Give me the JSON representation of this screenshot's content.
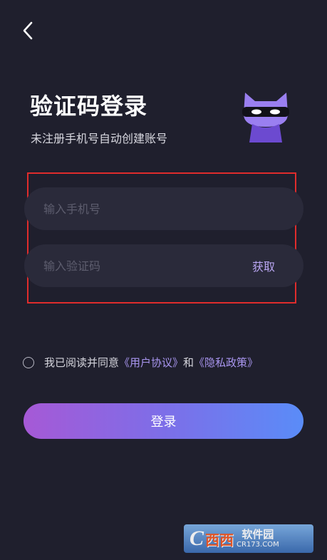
{
  "header": {
    "back_icon": "chevron-left-icon"
  },
  "title": "验证码登录",
  "subtitle": "未注册手机号自动创建账号",
  "mascot": {
    "icon": "masked-cat-icon",
    "body_color": "#7a4fd6",
    "face_color": "#a48cf0",
    "mask_color": "#111111"
  },
  "form": {
    "phone_placeholder": "输入手机号",
    "phone_value": "",
    "code_placeholder": "输入验证码",
    "code_value": "",
    "get_code_label": "获取"
  },
  "agreement": {
    "prefix": "我已阅读并同意",
    "user_agreement": "《用户协议》",
    "conjunction": "和",
    "privacy_policy": "《隐私政策》",
    "checked": false
  },
  "login_button": "登录",
  "colors": {
    "background": "#1f1f2d",
    "field": "#2a2a3a",
    "accent": "#a996f0",
    "highlight_border": "#e02c2c",
    "button_gradient_start": "#a659d6",
    "button_gradient_end": "#5a8cf8"
  },
  "watermark": {
    "logo": "C",
    "name_cn": "西西",
    "brand": "软件园",
    "url": "CR173.COM"
  }
}
